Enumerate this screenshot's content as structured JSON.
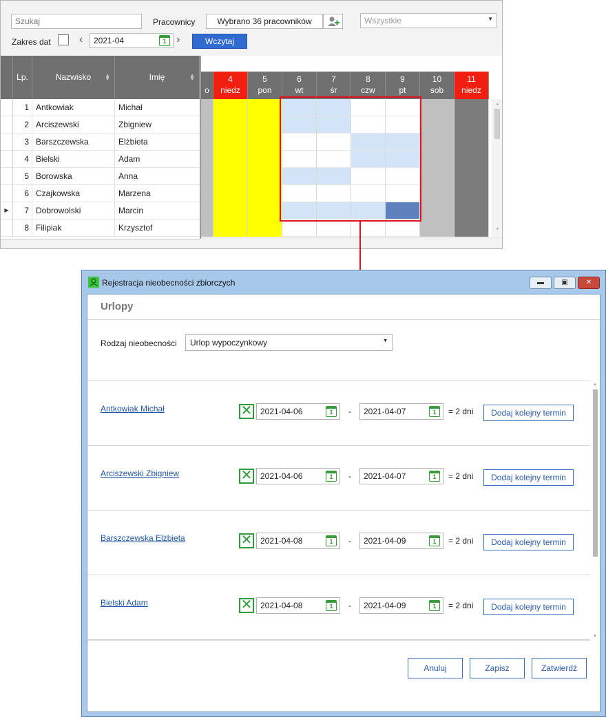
{
  "toolbar": {
    "search_placeholder": "Szukaj",
    "employees_label": "Pracownicy",
    "employees_value": "Wybrano 36 pracowników",
    "filter_value": "Wszystkie",
    "date_range_label": "Zakres dat",
    "month_value": "2021-04",
    "load_button": "Wczytaj"
  },
  "grid": {
    "col_lp": "Lp.",
    "col_surname": "Nazwisko",
    "col_name": "Imię",
    "rows": [
      {
        "lp": "1",
        "surname": "Antkowiak",
        "name": "Michał"
      },
      {
        "lp": "2",
        "surname": "Arciszewski",
        "name": "Zbigniew"
      },
      {
        "lp": "3",
        "surname": "Barszczewska",
        "name": "Elżbieta"
      },
      {
        "lp": "4",
        "surname": "Bielski",
        "name": "Adam"
      },
      {
        "lp": "5",
        "surname": "Borowska",
        "name": "Anna"
      },
      {
        "lp": "6",
        "surname": "Czajkowska",
        "name": "Marzena"
      },
      {
        "lp": "7",
        "surname": "Dobrowolski",
        "name": "Marcin"
      },
      {
        "lp": "8",
        "surname": "Filipiak",
        "name": "Krzysztof"
      }
    ],
    "days": [
      {
        "num": "4",
        "wd": "niedz",
        "type": "holiday"
      },
      {
        "num": "5",
        "wd": "pon",
        "type": "holiday"
      },
      {
        "num": "6",
        "wd": "wt",
        "type": "work"
      },
      {
        "num": "7",
        "wd": "śr",
        "type": "work"
      },
      {
        "num": "8",
        "wd": "czw",
        "type": "work"
      },
      {
        "num": "9",
        "wd": "pt",
        "type": "work"
      },
      {
        "num": "10",
        "wd": "sob",
        "type": "sat"
      },
      {
        "num": "11",
        "wd": "niedz",
        "type": "sun"
      }
    ],
    "partial_prev_day_wd": "o",
    "absences": [
      [
        0,
        1,
        0,
        0
      ],
      [
        0,
        1,
        0,
        0
      ],
      [
        0,
        1,
        0,
        0
      ],
      [
        0,
        1,
        0,
        0
      ],
      [
        0,
        0,
        1,
        1
      ],
      [
        0,
        0,
        1,
        1
      ],
      [
        0,
        0,
        0,
        0
      ],
      [
        0,
        0,
        0,
        0
      ]
    ],
    "colors": {
      "holiday": "#ffff00",
      "saturday": "#c0c0c0",
      "sunday": "#7c7c7c",
      "absence": "#d4e4f7",
      "selected": "#5e82bd",
      "highlight_border": "#e0141e"
    }
  },
  "dialog": {
    "title": "Rejestracja nieobecności zbiorczych",
    "header": "Urlopy",
    "absence_type_label": "Rodzaj nieobecności",
    "absence_type_value": "Urlop wypoczynkowy",
    "entries": [
      {
        "employee": "Antkowiak Michał",
        "from": "2021-04-06",
        "to": "2021-04-07",
        "days": "= 2 dni",
        "add_label": "Dodaj kolejny termin"
      },
      {
        "employee": "Arciszewski Zbigniew",
        "from": "2021-04-06",
        "to": "2021-04-07",
        "days": "= 2 dni",
        "add_label": "Dodaj kolejny termin"
      },
      {
        "employee": "Barszczewska Elżbieta",
        "from": "2021-04-08",
        "to": "2021-04-09",
        "days": "= 2 dni",
        "add_label": "Dodaj kolejny termin"
      },
      {
        "employee": "Bielski Adam",
        "from": "2021-04-08",
        "to": "2021-04-09",
        "days": "= 2 dni",
        "add_label": "Dodaj kolejny termin"
      }
    ],
    "dash": "-",
    "cancel_button": "Anuluj",
    "save_button": "Zapisz",
    "confirm_button": "Zatwierdź"
  }
}
